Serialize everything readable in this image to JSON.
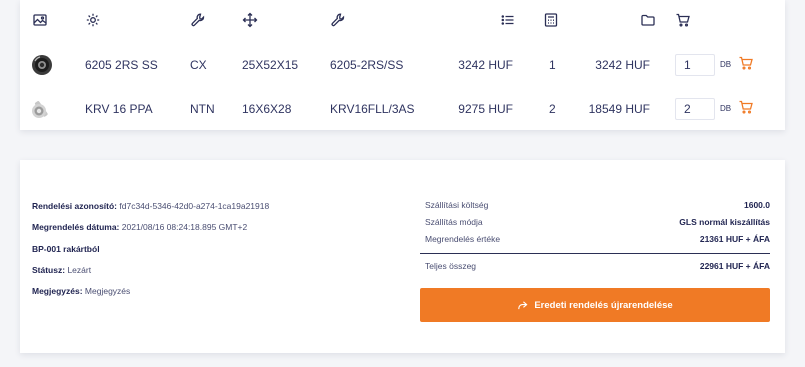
{
  "header_icons": [
    "image-icon",
    "gear-icon",
    "wrench-icon",
    "move-icon",
    "wrench-icon",
    "list-icon",
    "calculator-icon",
    "folder-icon",
    "cart-icon"
  ],
  "products": [
    {
      "image": "bearing-black-seal",
      "name": "6205 2RS SS",
      "brand": "CX",
      "size": "25X52X15",
      "code": "6205-2RS/SS",
      "unit_price": "3242 HUF",
      "quantity": "1",
      "total": "3242 HUF",
      "qty_input": "1",
      "unit_label": "DB"
    },
    {
      "image": "bearing-metal",
      "name": "KRV 16 PPA",
      "brand": "NTN",
      "size": "16X6X28",
      "code": "KRV16FLL/3AS",
      "unit_price": "9275 HUF",
      "quantity": "2",
      "total": "18549 HUF",
      "qty_input": "2",
      "unit_label": "DB"
    }
  ],
  "order": {
    "id_label": "Rendelési azonosító:",
    "id_value": "fd7c34d-5346-42d0-a274-1ca19a21918",
    "date_label": "Megrendelés dátuma:",
    "date_value": "2021/08/16 08:24:18.895 GMT+2",
    "warehouse": "BP-001 rakártból",
    "status_label": "Státusz:",
    "status_value": "Lezárt",
    "note_label": "Megjegyzés:",
    "note_value": "Megjegyzés"
  },
  "summary": {
    "shipping_cost_label": "Szállítási költség",
    "shipping_cost_value": "1600.0",
    "shipping_method_label": "Szállítás módja",
    "shipping_method_value": "GLS normál kiszállítás",
    "order_value_label": "Megrendelés értéke",
    "order_value_value": "21361 HUF + ÁFA",
    "total_label": "Teljes összeg",
    "total_value": "22961 HUF + ÁFA"
  },
  "reorder_button": "Eredeti rendelés újrarendelése",
  "colors": {
    "accent": "#f07a25",
    "text": "#2b2f55",
    "background": "#f4f5f8"
  }
}
